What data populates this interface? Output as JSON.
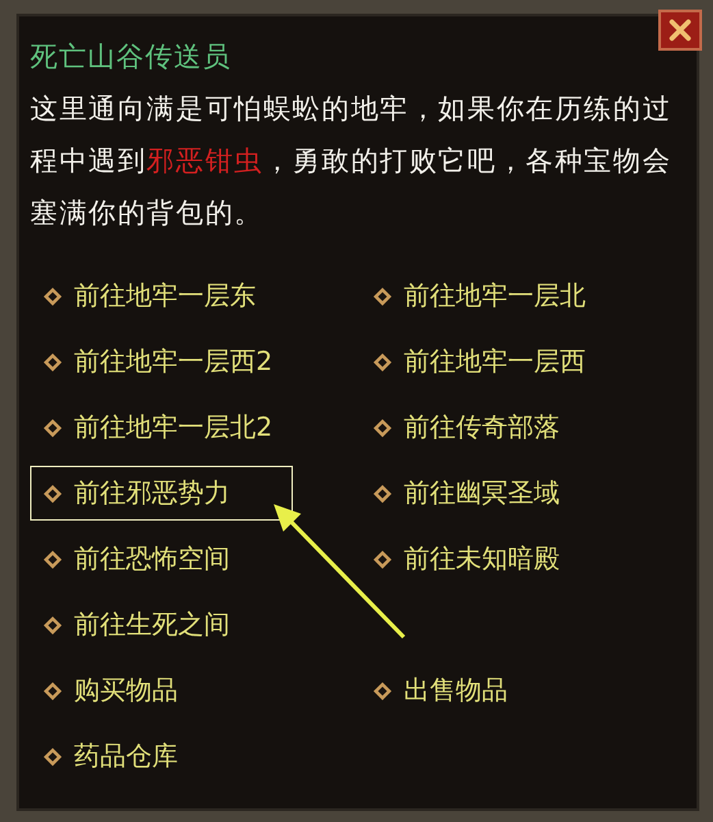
{
  "window": {
    "title": "死亡山谷传送员"
  },
  "description": "这里通向满是可怕蜈蚣的地牢，如果你在历练的过程中遇到**邪恶钳虫**，勇敢的打败它吧，各种宝物会塞满你的背包的。",
  "options": [
    [
      {
        "label": "前往地牢一层东",
        "highlighted": false
      },
      {
        "label": "前往地牢一层北",
        "highlighted": false
      }
    ],
    [
      {
        "label": "前往地牢一层西2",
        "highlighted": false
      },
      {
        "label": "前往地牢一层西",
        "highlighted": false
      }
    ],
    [
      {
        "label": "前往地牢一层北2",
        "highlighted": false
      },
      {
        "label": "前往传奇部落",
        "highlighted": false
      }
    ],
    [
      {
        "label": "前往邪恶势力",
        "highlighted": true
      },
      {
        "label": "前往幽冥圣域",
        "highlighted": false
      }
    ],
    [
      {
        "label": "前往恐怖空间",
        "highlighted": false
      },
      {
        "label": "前往未知暗殿",
        "highlighted": false
      }
    ],
    [
      {
        "label": "前往生死之间",
        "highlighted": false
      }
    ],
    [
      {
        "label": "购买物品",
        "highlighted": false
      },
      {
        "label": "出售物品",
        "highlighted": false
      }
    ],
    [
      {
        "label": "药品仓库",
        "highlighted": false
      }
    ]
  ]
}
